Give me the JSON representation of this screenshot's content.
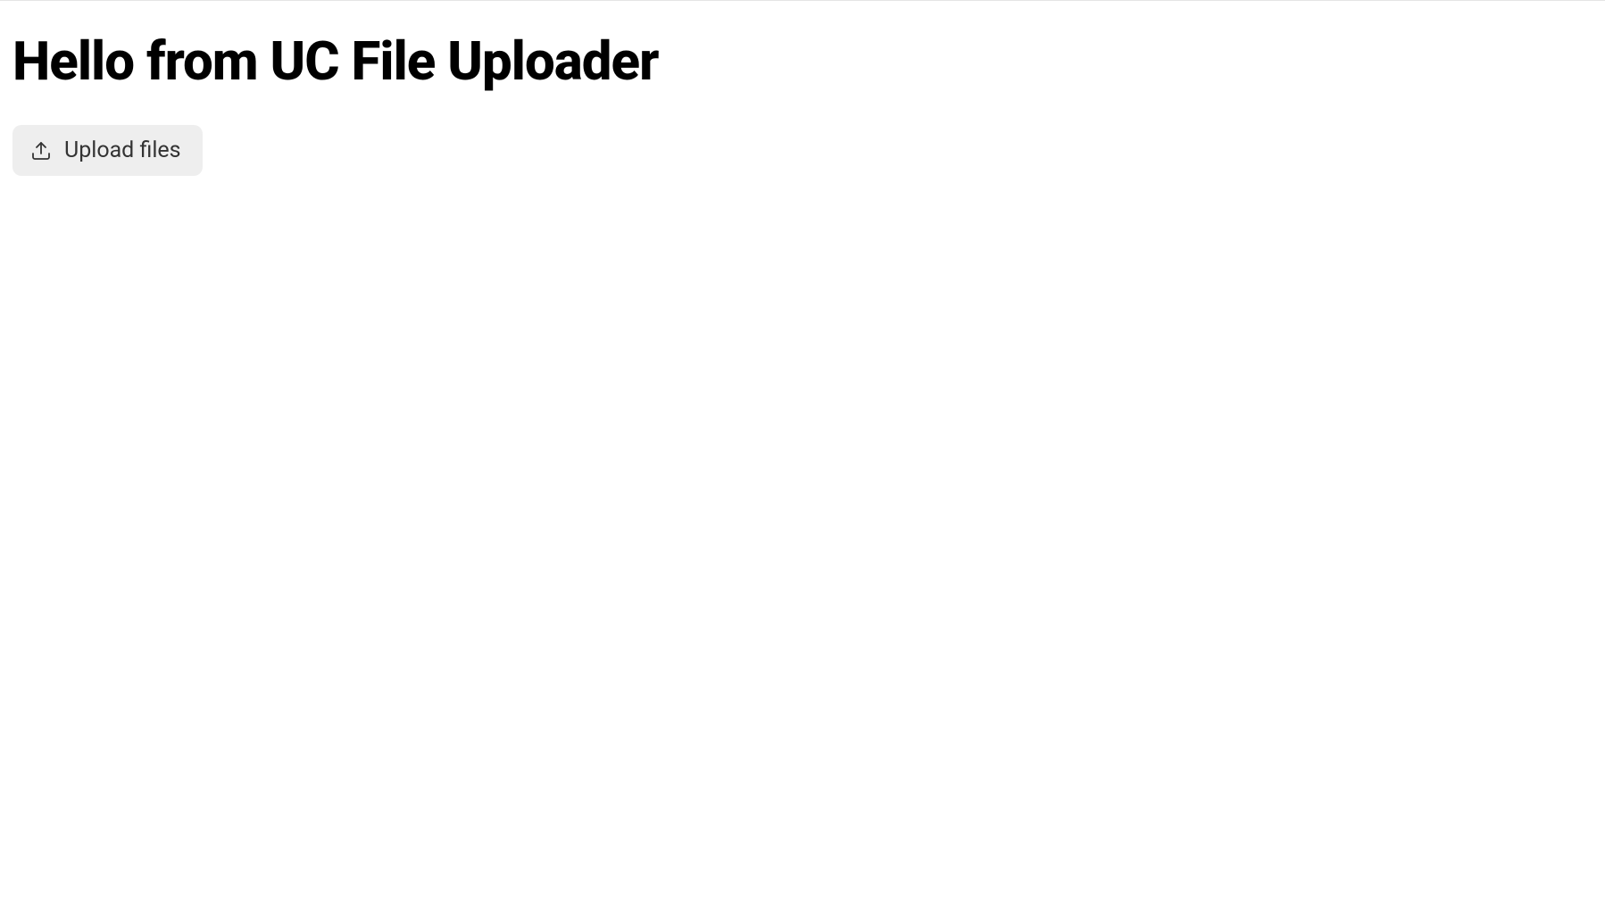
{
  "page": {
    "title": "Hello from UC File Uploader"
  },
  "upload": {
    "button_label": "Upload files"
  }
}
